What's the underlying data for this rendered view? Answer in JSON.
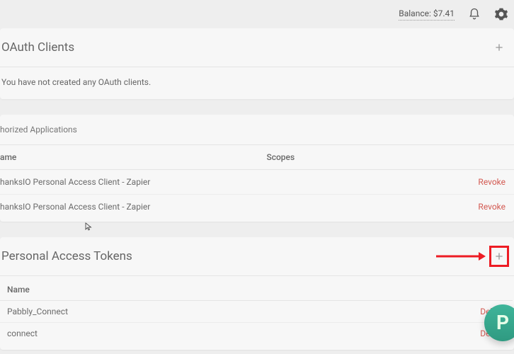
{
  "topbar": {
    "balance": "Balance: $7.41"
  },
  "oauth": {
    "title": "OAuth Clients",
    "empty": "You have not created any OAuth clients."
  },
  "authorized": {
    "title": "horized Applications",
    "columns": {
      "name": "ame",
      "scopes": "Scopes"
    },
    "rows": [
      {
        "name": "hanksIO Personal Access Client - Zapier",
        "action": "Revoke"
      },
      {
        "name": "hanksIO Personal Access Client - Zapier",
        "action": "Revoke"
      }
    ]
  },
  "tokens": {
    "title": "Personal Access Tokens",
    "columns": {
      "name": "Name"
    },
    "rows": [
      {
        "name": "Pabbly_Connect",
        "action": "Delete"
      },
      {
        "name": "connect",
        "action": "Delete"
      }
    ]
  },
  "float_badge": "P"
}
